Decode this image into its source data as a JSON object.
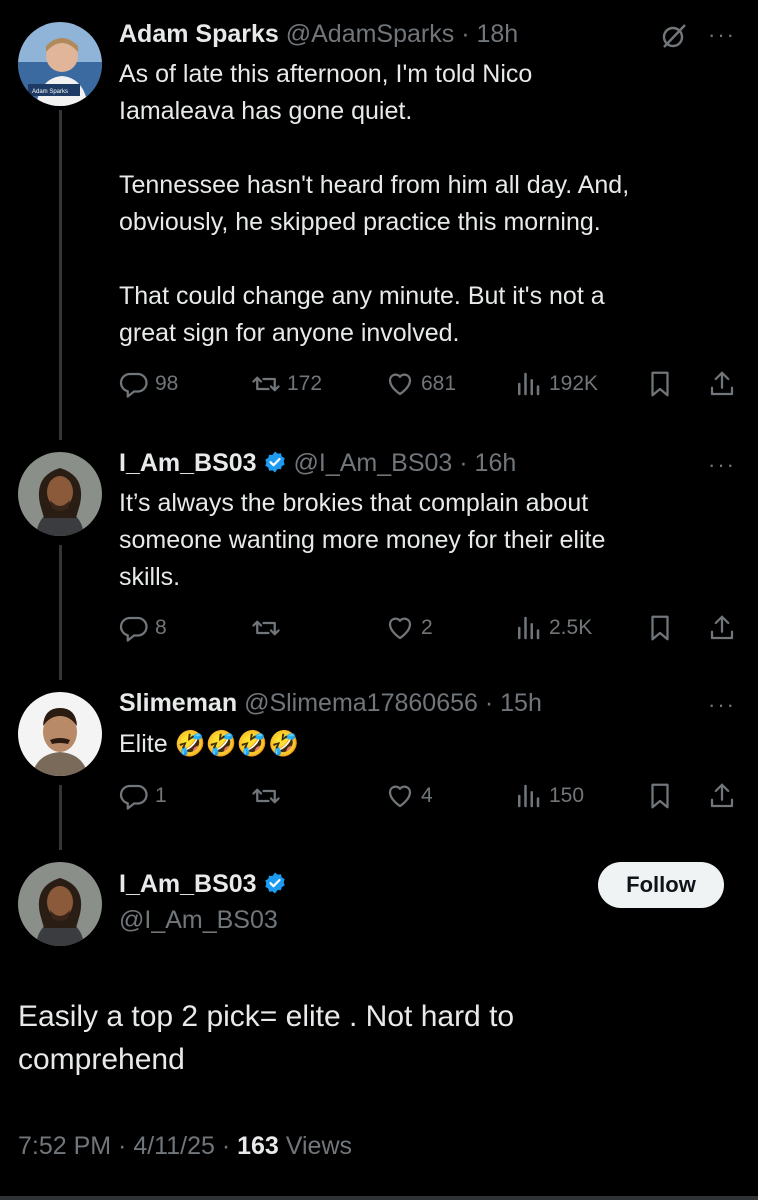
{
  "tweets": [
    {
      "name": "Adam Sparks",
      "handle": "@AdamSparks",
      "time": "· 18h",
      "verified": false,
      "avatar_caption": "Adam Sparks",
      "text": "As of late this afternoon, I'm told Nico\nIamaleava has gone quiet.\n\nTennessee hasn't heard from him all day. And,\nobviously, he skipped practice this morning.\n\nThat could change any minute. But it's not a\ngreat sign for anyone involved.",
      "replies": "98",
      "reposts": "172",
      "likes": "681",
      "views": "192K"
    },
    {
      "name": "I_Am_BS03",
      "handle": "@I_Am_BS03",
      "time": "· 16h",
      "verified": true,
      "text": "It’s always the brokies that complain about\nsomeone wanting more money for their elite\nskills.",
      "replies": "8",
      "reposts": "",
      "likes": "2",
      "views": "2.5K"
    },
    {
      "name": "Slimeman",
      "handle": "@Slimema17860656",
      "time": "· 15h",
      "verified": false,
      "text": "Elite 🤣🤣🤣🤣",
      "replies": "1",
      "reposts": "",
      "likes": "4",
      "views": "150"
    }
  ],
  "main_tweet": {
    "name": "I_Am_BS03",
    "handle": "@I_Am_BS03",
    "verified": true,
    "follow_label": "Follow",
    "text": "Easily a top 2 pick= elite . Not hard to\ncomprehend",
    "time": "7:52 PM · 4/11/25 · ",
    "views_count": "163",
    "views_label": " Views"
  },
  "more_glyph": "···",
  "colors": {
    "background": "#000000",
    "text": "#e7e9ea",
    "muted": "#71767b",
    "verified": "#1d9bf0"
  },
  "icons": [
    "reply-icon",
    "repost-icon",
    "like-icon",
    "views-icon",
    "bookmark-icon",
    "share-icon",
    "grok-icon",
    "verified-badge-icon"
  ]
}
